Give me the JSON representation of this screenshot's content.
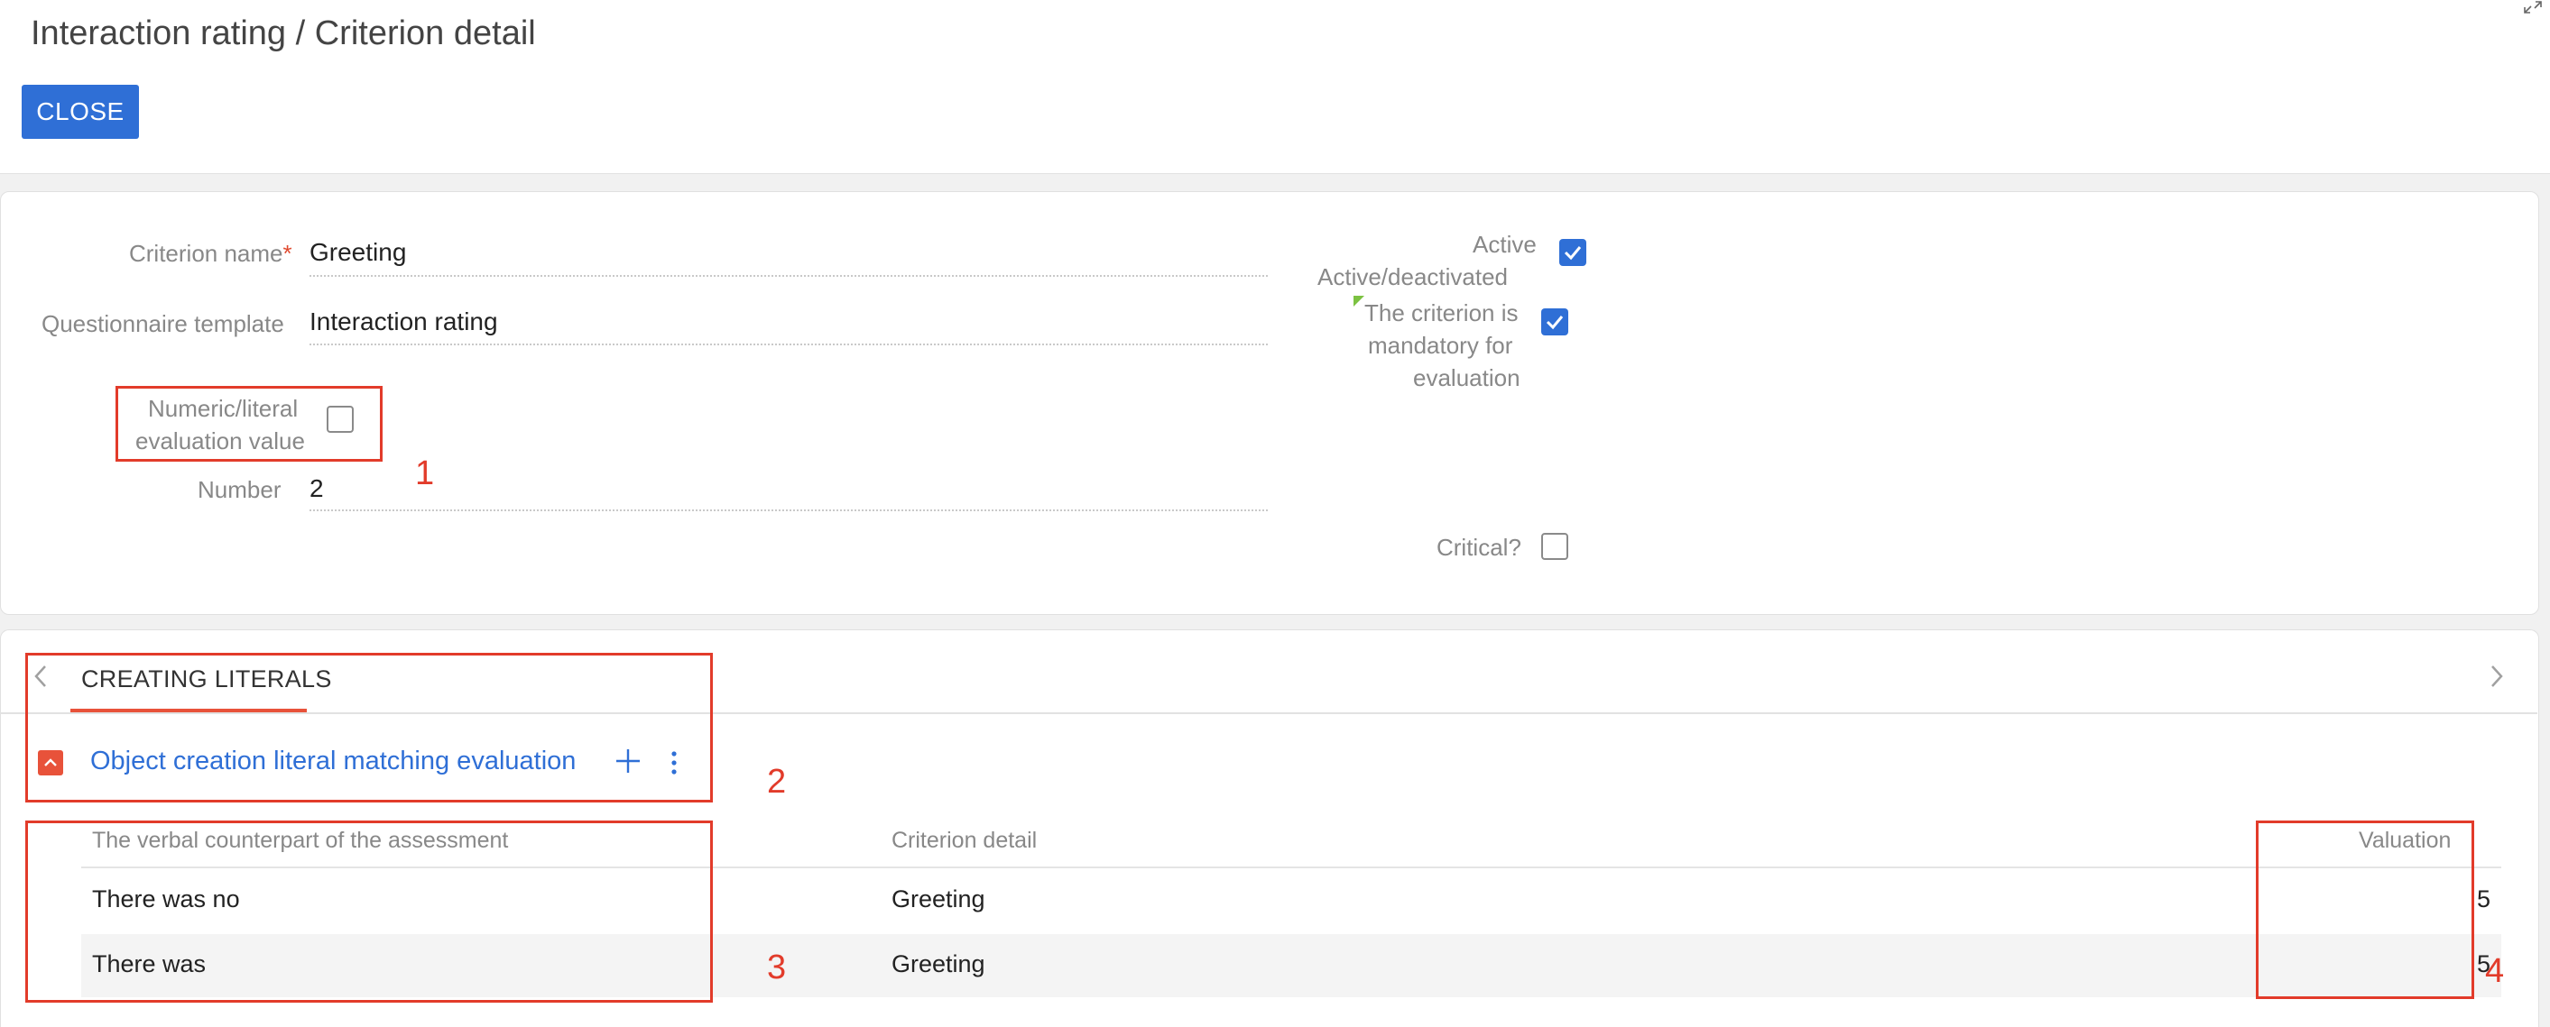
{
  "header": {
    "title": "Interaction rating / Criterion detail",
    "close_label": "CLOSE",
    "expand_icon": "expand-icon"
  },
  "form": {
    "criterion_name_label": "Criterion name",
    "required_mark": "*",
    "criterion_name_value": "Greeting",
    "questionnaire_label": "Questionnaire template",
    "questionnaire_value": "Interaction rating",
    "numeric_literal_label_1": "Numeric/literal",
    "numeric_literal_label_2": "evaluation value",
    "numeric_literal_checked": false,
    "number_label": "Number",
    "number_value": "2",
    "active_label_1": "Active",
    "active_label_2": "Active/deactivated",
    "active_checked": true,
    "mandatory_label_1": "The criterion is",
    "mandatory_label_2": "mandatory for",
    "mandatory_label_3": "evaluation",
    "mandatory_checked": true,
    "critical_label": "Critical?",
    "critical_checked": false
  },
  "tabs": {
    "active_tab": "CREATING LITERALS"
  },
  "detail_section": {
    "title": "Object creation literal matching evaluation",
    "columns": [
      "The verbal counterpart of the assessment",
      "Criterion detail",
      "Valuation"
    ],
    "rows": [
      {
        "verbal": "There was no",
        "criterion": "Greeting",
        "valuation": "5"
      },
      {
        "verbal": "There was",
        "criterion": "Greeting",
        "valuation": "5"
      }
    ]
  },
  "annotations": {
    "n1": "1",
    "n2": "2",
    "n3": "3",
    "n4": "4"
  },
  "colors": {
    "accent_blue": "#2f6fd6",
    "accent_orange": "#e8523a",
    "annotation_red": "#e23b2a"
  }
}
